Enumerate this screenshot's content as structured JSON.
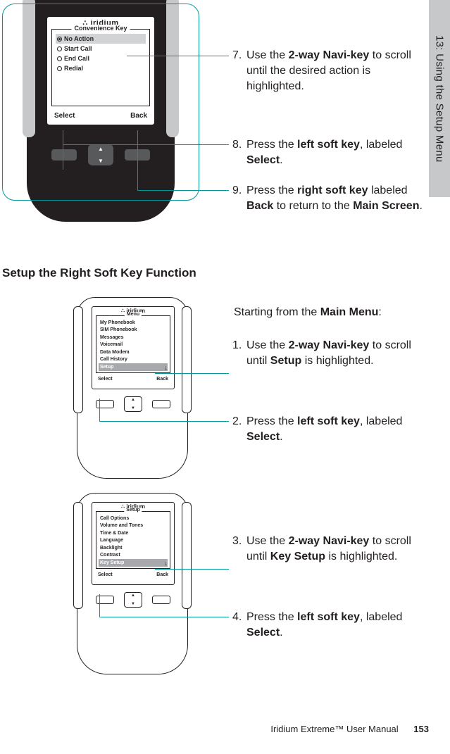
{
  "side_tab": "13: Using the Setup Menu",
  "top_phone": {
    "logo": "iridium",
    "menu_title": "Convenience Key",
    "options": [
      "No Action",
      "Start Call",
      "End Call",
      "Redial"
    ],
    "selected_index": 0,
    "soft_left": "Select",
    "soft_right": "Back"
  },
  "top_steps": {
    "s7": {
      "n": "7.",
      "text_a": "Use the ",
      "b1": "2-way Navi-key",
      "text_b": " to scroll until the desired action is highlighted."
    },
    "s8": {
      "n": "8.",
      "text_a": "Press the ",
      "b1": "left soft key",
      "text_b": ", labeled ",
      "b2": "Select",
      "text_c": "."
    },
    "s9": {
      "n": "9.",
      "text_a": "Press the ",
      "b1": "right soft key",
      "text_b": " labeled ",
      "b2": "Back",
      "text_c": " to return to the ",
      "b3": "Main Screen",
      "text_d": "."
    }
  },
  "section_heading": "Setup the Right Soft Key Function",
  "mid_intro": {
    "a": "Starting from the ",
    "b": "Main Menu",
    "c": ":"
  },
  "phone2": {
    "logo": "iridium",
    "menu_title": "Menu",
    "items": [
      "My Phonebook",
      "SIM Phonebook",
      "Messages",
      "Voicemail",
      "Data Modem",
      "Call History",
      "Setup"
    ],
    "selected_index": 6,
    "soft_left": "Select",
    "soft_right": "Back"
  },
  "mid_steps": {
    "s1": {
      "n": "1.",
      "text_a": "Use the ",
      "b1": "2-way Navi-key",
      "text_b": " to scroll until ",
      "b2": "Setup",
      "text_c": " is highlighted."
    },
    "s2": {
      "n": "2.",
      "text_a": "Press the ",
      "b1": "left soft key",
      "text_b": ", labeled ",
      "b2": "Select",
      "text_c": "."
    }
  },
  "phone3": {
    "logo": "iridium",
    "menu_title": "Setup",
    "items": [
      "Call Options",
      "Volume and Tones",
      "Time & Date",
      "Language",
      "Backlight",
      "Contrast",
      "Key Setup"
    ],
    "selected_index": 6,
    "soft_left": "Select",
    "soft_right": "Back"
  },
  "bot_steps": {
    "s3": {
      "n": "3.",
      "text_a": "Use the ",
      "b1": "2-way Navi-key",
      "text_b": " to scroll until ",
      "b2": "Key Setup",
      "text_c": " is highlighted."
    },
    "s4": {
      "n": "4.",
      "text_a": "Press the ",
      "b1": "left soft key",
      "text_b": ", labeled ",
      "b2": "Select",
      "text_c": "."
    }
  },
  "footer": {
    "title": "Iridium Extreme™ User Manual",
    "page": "153"
  }
}
